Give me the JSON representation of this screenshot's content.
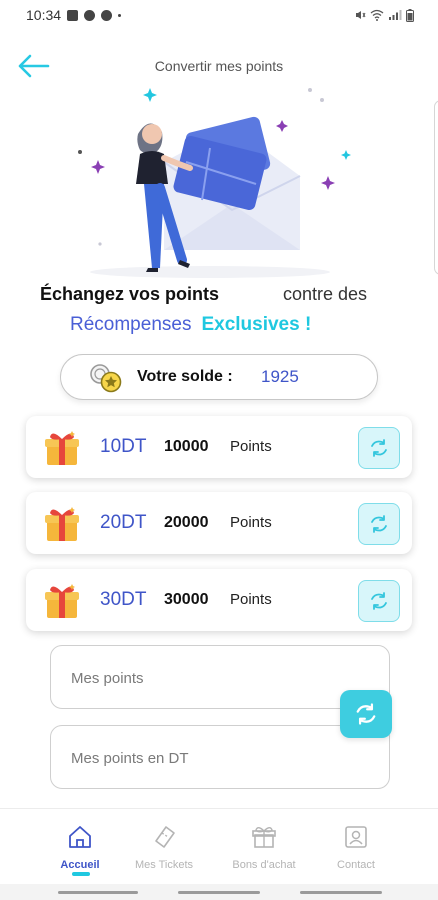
{
  "status_bar": {
    "time": "10:34"
  },
  "header": {
    "title": "Convertir mes points"
  },
  "headline": {
    "part1": "Échangez vos points",
    "part2": "contre des",
    "part3": "Récompenses",
    "part4": "Exclusives !"
  },
  "balance": {
    "label": "Votre solde :",
    "value": "1925"
  },
  "rewards": [
    {
      "amount": "10DT",
      "points": "10000",
      "unit": "Points"
    },
    {
      "amount": "20DT",
      "points": "20000",
      "unit": "Points"
    },
    {
      "amount": "30DT",
      "points": "30000",
      "unit": "Points"
    }
  ],
  "converter": {
    "points_placeholder": "Mes points",
    "dt_placeholder": "Mes points en DT"
  },
  "nav": [
    {
      "label": "Accueil",
      "icon": "home-icon",
      "active": true
    },
    {
      "label": "Mes Tickets",
      "icon": "ticket-icon",
      "active": false
    },
    {
      "label": "Bons d'achat",
      "icon": "gift-icon",
      "active": false
    },
    {
      "label": "Contact",
      "icon": "contact-icon",
      "active": false
    }
  ],
  "colors": {
    "primary_blue": "#3f55c8",
    "accent_cyan": "#1fc8e0"
  }
}
